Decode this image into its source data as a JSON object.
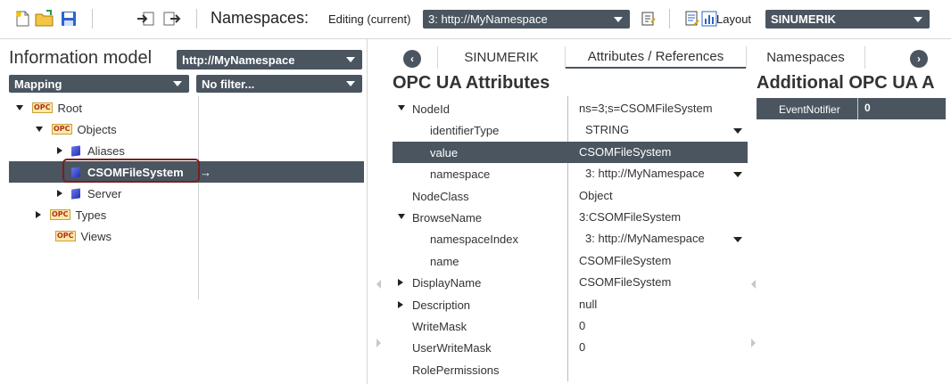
{
  "toolbar": {
    "namespaces_title": "Namespaces:",
    "editing_label": "Editing (current)",
    "namespace_select": "3: http://MyNamespace",
    "layout_label": "Layout",
    "project_select": "SINUMERIK",
    "icons": [
      "new-file-icon",
      "open-folder-icon",
      "save-icon",
      "import-icon",
      "export-icon",
      "edit-namespace-icon",
      "list-edit-icon",
      "layout-chart-icon"
    ]
  },
  "left": {
    "title": "Information model",
    "model_select": "http://MyNamespace",
    "mapping_select": "Mapping",
    "filter_select": "No filter...",
    "tree": [
      {
        "label": "Root",
        "icon": "opc-icon",
        "expander": "expanded"
      },
      {
        "label": "Objects",
        "icon": "opc-icon",
        "expander": "expanded"
      },
      {
        "label": "Aliases",
        "icon": "cube-icon",
        "expander": "collapsed"
      },
      {
        "label": "CSOMFileSystem",
        "icon": "cube-icon",
        "expander": "none",
        "selected": true
      },
      {
        "label": "Server",
        "icon": "cube-icon",
        "expander": "collapsed"
      },
      {
        "label": "Types",
        "icon": "opc-icon",
        "expander": "collapsed"
      },
      {
        "label": "Views",
        "icon": "opc-icon",
        "expander": "none"
      }
    ],
    "selected_arrow": "→"
  },
  "tabs": [
    {
      "label": "SINUMERIK",
      "active": false
    },
    {
      "label": "Attributes / References",
      "active": true
    },
    {
      "label": "Namespaces",
      "active": false
    }
  ],
  "attributes": {
    "title": "OPC UA Attributes",
    "rows": [
      {
        "name": "NodeId",
        "value": "ns=3;s=CSOMFileSystem",
        "expander": "expanded",
        "indent": 0
      },
      {
        "name": "identifierType",
        "value": "STRING",
        "dropdown": true,
        "indent": 1
      },
      {
        "name": "value",
        "value": "CSOMFileSystem",
        "indent": 1,
        "selected": true
      },
      {
        "name": "namespace",
        "value": "3: http://MyNamespace",
        "dropdown": true,
        "indent": 1
      },
      {
        "name": "NodeClass",
        "value": "Object",
        "indent": 0
      },
      {
        "name": "BrowseName",
        "value": "3:CSOMFileSystem",
        "expander": "expanded",
        "indent": 0
      },
      {
        "name": "namespaceIndex",
        "value": "3: http://MyNamespace",
        "dropdown": true,
        "indent": 1
      },
      {
        "name": "name",
        "value": "CSOMFileSystem",
        "indent": 1
      },
      {
        "name": "DisplayName",
        "value": "CSOMFileSystem",
        "expander": "collapsed",
        "indent": 0
      },
      {
        "name": "Description",
        "value": "null",
        "expander": "collapsed",
        "indent": 0
      },
      {
        "name": "WriteMask",
        "value": "0",
        "indent": 0
      },
      {
        "name": "UserWriteMask",
        "value": "0",
        "indent": 0
      },
      {
        "name": "RolePermissions",
        "value": "",
        "indent": 0
      }
    ]
  },
  "additional": {
    "title": "Additional OPC UA A",
    "rows": [
      {
        "name": "EventNotifier",
        "value": "0"
      }
    ]
  },
  "colors": {
    "accent_dark": "#4a5560",
    "selection_outline": "#7a1f1f"
  }
}
